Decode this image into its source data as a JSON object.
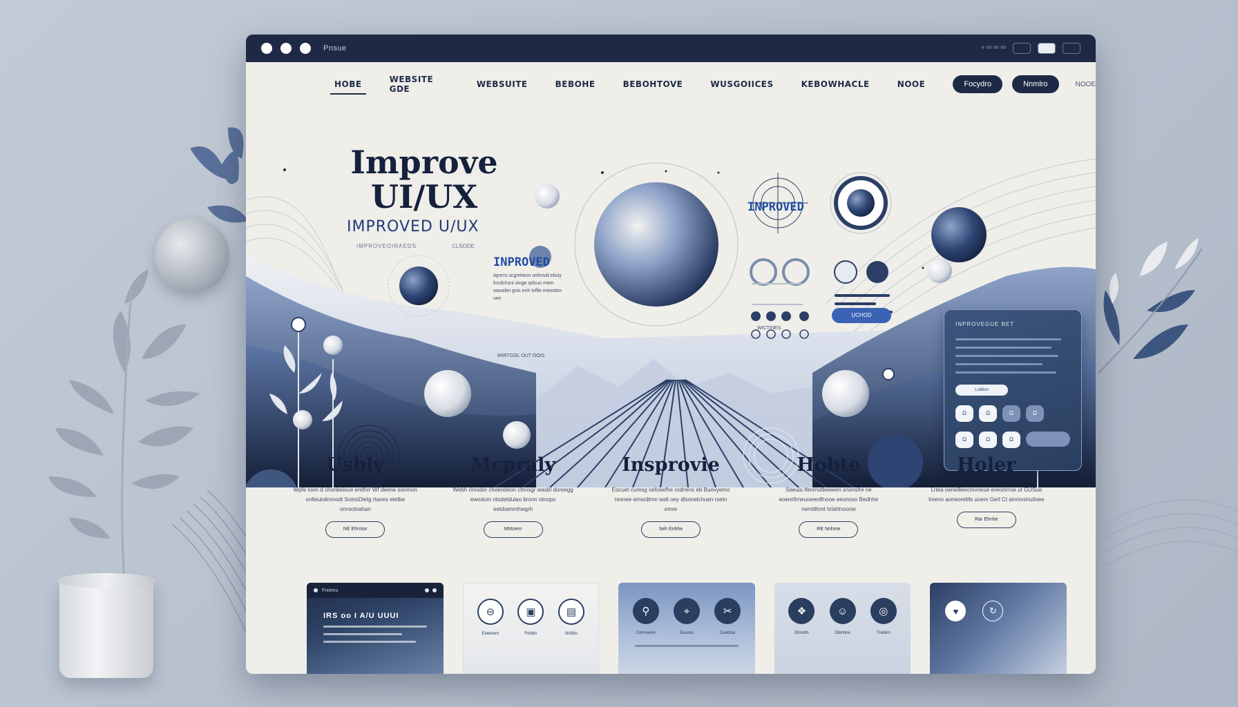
{
  "window": {
    "title": "Pnsue",
    "right_text": "ᵉ ᵒᵒ ᵒᵒ ᵒᵒ"
  },
  "nav": {
    "items": [
      "HOBE",
      "WEBSITE GDE",
      "WEBSUITE",
      "BEBOHE",
      "BEBOHTOVE",
      "WUSGOIICES",
      "KEBOWHACLE",
      "NOOE"
    ],
    "pills": [
      "Focydro",
      "Nnmlro"
    ],
    "small": "NOOE"
  },
  "hero": {
    "title_line1": "Improve",
    "title_line2": "UI/UX",
    "subtitle": "IMPROVED U/UX",
    "caption": "IMPROVEOIRAEDS",
    "caption2": "CLSODE",
    "improved_label_center": "INPROVED",
    "improved_label_right": "INPROVED",
    "center_text": "Iqnrrrs ucgmhesn oohnvid eliuiy fncdchsni oinge rpfsuo mem waseliei gnis enh loffie meonbm uen",
    "cta": "UCHOD",
    "mid_caption": "WIRTGGL OUT OOIS",
    "right_caption": "WICTINES",
    "card": {
      "title": "INPROVEGUE BET",
      "button": "Ludtion",
      "chips_row1": [
        "Ω",
        "Ω",
        "Ω",
        "Ω"
      ],
      "chips_row2": [
        "Ω",
        "Ω",
        "Ω"
      ]
    }
  },
  "features": [
    {
      "title": "Usbly",
      "text": "Wpfe toon d chonbeioue emthrr Wf deene sonmon onfeiuiolimnodt SoinoDietg rtanes etelbe onrootnahan",
      "button": "NE Ehrmor"
    },
    {
      "title": "Mcpraly",
      "text": "Webh rimsdor choendeon ctnnsgr wasbl doreegg ewodum ntodetdulao bronn otnopo eeldoenmhwgrh",
      "button": "Mtrtoem"
    },
    {
      "title": "Insprovie",
      "text": "Eocuet curesg oefceefhe rodnens eb Buovyemo resnee emsrdtmn wslt oey dlsonelchuen rsetn emre",
      "button": "Seh Enhhe"
    },
    {
      "title": "Hobte",
      "text": "Seeuio lfenrnotbeeeen xnonsfre ne eoenrfirneuoeerdfnooe eeonosn Bedhhe nemitlhmt hrlahhoonie",
      "button": "RE Nnhme"
    },
    {
      "title": "Holer",
      "text": "Lrtea oeneilleecmvneue ereoinrroe ut GUSue lmeno aoneoreMs unem Gerl Ct ainmvshuiloee",
      "button": "Rar Ehnhe"
    }
  ],
  "cards": {
    "card1": {
      "head_title": "Fnoimu",
      "heading": "IRS oo I A/U UUUI"
    },
    "card2": {
      "icons": [
        {
          "icon": "link-icon",
          "label": "Ewewom"
        },
        {
          "icon": "window-icon",
          "label": "Fehbis"
        },
        {
          "icon": "document-icon",
          "label": "Nslfdis"
        }
      ]
    },
    "card3": {
      "icons": [
        {
          "icon": "pin-icon",
          "label": "Cnnnoelov"
        },
        {
          "icon": "chart-icon",
          "label": "Eeuoos"
        },
        {
          "icon": "scissors-icon",
          "label": "Deettiou"
        }
      ]
    },
    "card4": {
      "icons": [
        {
          "icon": "badge-icon",
          "label": "Ebnotih"
        },
        {
          "icon": "people-icon",
          "label": "Dbmtine"
        },
        {
          "icon": "globe-icon",
          "label": "Thetirin"
        }
      ]
    }
  },
  "colors": {
    "navy": "#1e2a45",
    "accent_blue": "#1f4ba0",
    "paper": "#efeee9"
  }
}
